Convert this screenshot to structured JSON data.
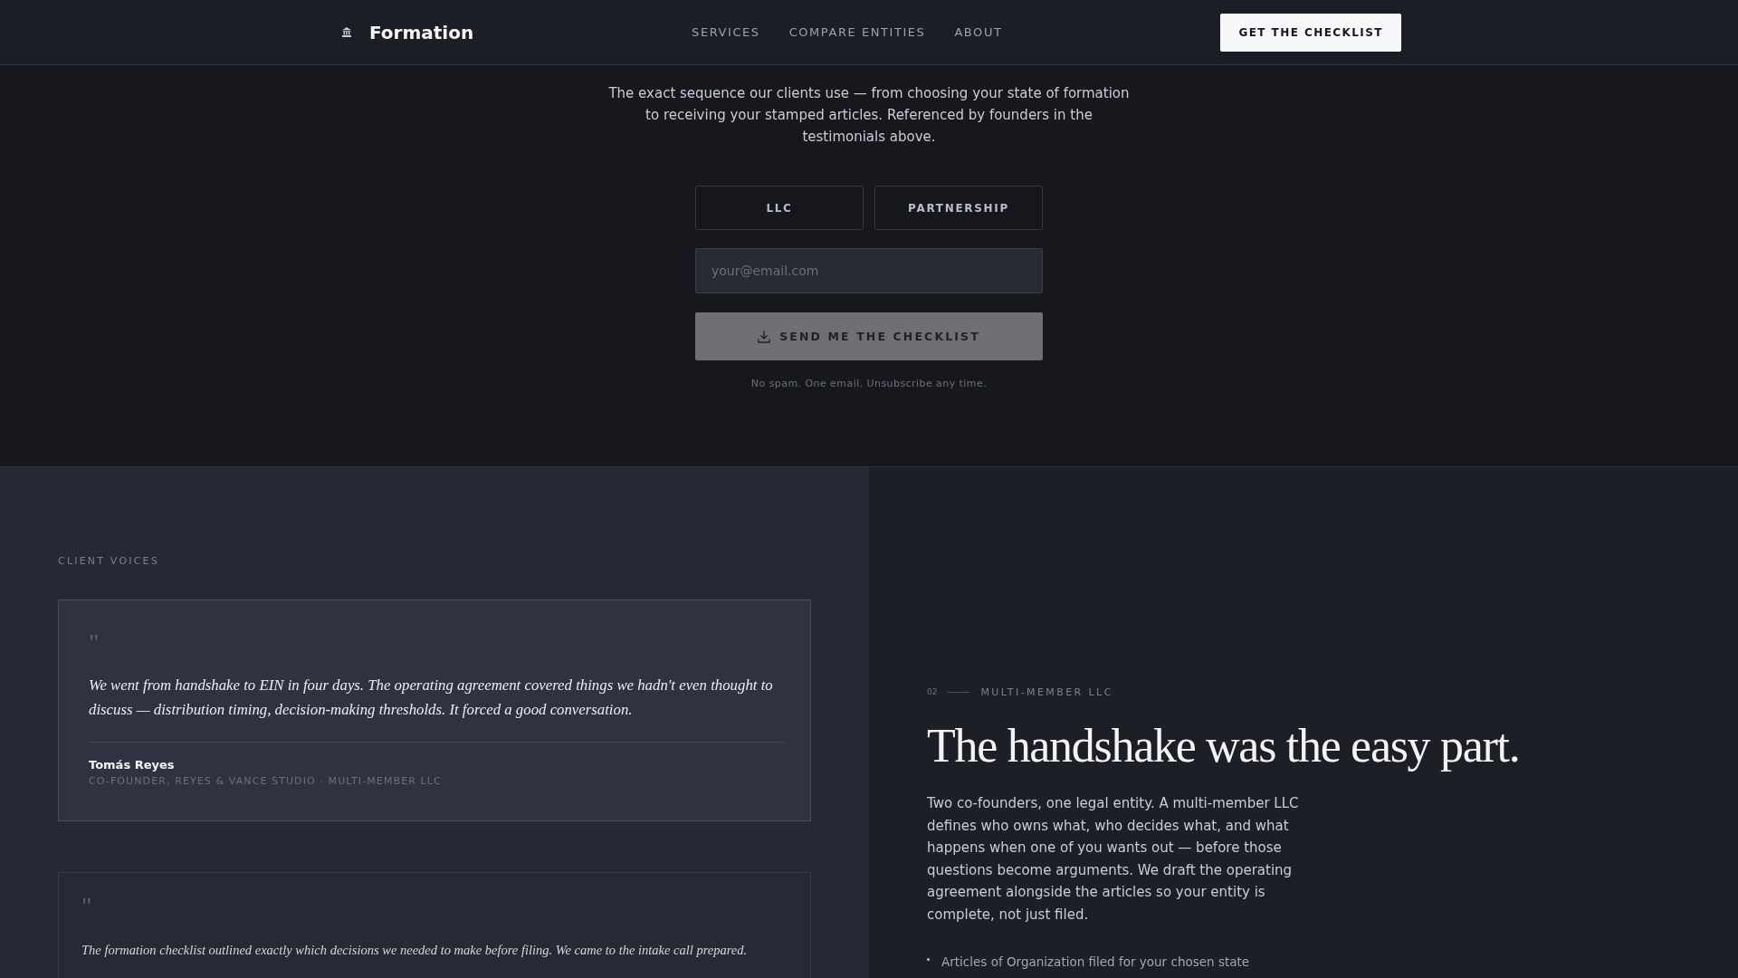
{
  "header": {
    "brand": "Formation",
    "nav": [
      "SERVICES",
      "COMPARE ENTITIES",
      "ABOUT"
    ],
    "cta": "GET THE CHECKLIST"
  },
  "checklist": {
    "description": "The exact sequence our clients use — from choosing your state of formation to receiving your stamped articles. Referenced by founders in the testimonials above.",
    "entity_options": [
      {
        "label": "LLC",
        "selected": false
      },
      {
        "label": "PARTNERSHIP",
        "selected": false
      }
    ],
    "email_field": {
      "placeholder": "your@email.com"
    },
    "submit": {
      "label": "SEND ME THE CHECKLIST",
      "disabled": true
    },
    "note": "No spam. One email. Unsubscribe any time."
  },
  "client_voices": {
    "label": "CLIENT VOICES",
    "testimonials": [
      {
        "quote_mark": "\"",
        "quote": "We went from handshake to EIN in four days. The operating agreement covered things we hadn't even thought to discuss — distribution timing, decision-making thresholds. It forced a good conversation.",
        "name": "Tomás Reyes",
        "role": "CO-FOUNDER, REYES & VANCE STUDIO · MULTI-MEMBER LLC",
        "active": true
      },
      {
        "quote_mark": "\"",
        "quote": "The formation checklist outlined exactly which decisions we needed to make before filing. We came to the intake call prepared.",
        "active": false
      }
    ]
  },
  "entity_detail": {
    "number": "02",
    "label": "MULTI-MEMBER LLC",
    "title": "The handshake was the easy part.",
    "description": "Two co-founders, one legal entity. A multi-member LLC defines who owns what, who decides what, and what happens when one of you wants out — before those questions become arguments. We draft the operating agreement alongside the articles so your entity is complete, not just filed.",
    "features": [
      "Articles of Organization filed for your chosen state"
    ]
  }
}
